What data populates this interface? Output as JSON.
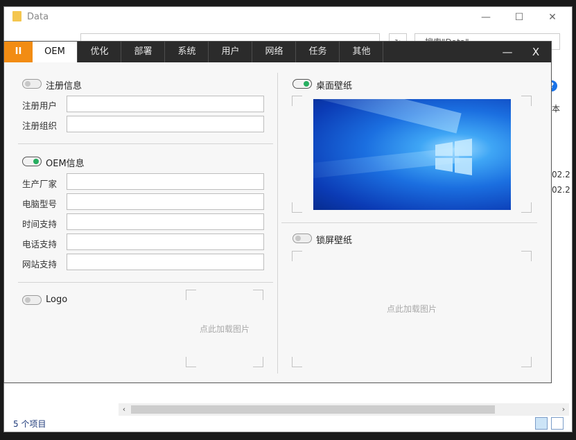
{
  "explorer": {
    "title": "Data",
    "window_controls": {
      "minimize": "—",
      "maximize": "☐",
      "close": "✕"
    },
    "search_placeholder": "搜索\"Data\"",
    "side_text": [
      "本",
      "02.2",
      "02.2"
    ],
    "status": "5 个项目"
  },
  "app": {
    "tabs": [
      {
        "label": "OEM",
        "active": true
      },
      {
        "label": "优化",
        "active": false
      },
      {
        "label": "部署",
        "active": false
      },
      {
        "label": "系统",
        "active": false
      },
      {
        "label": "用户",
        "active": false
      },
      {
        "label": "网络",
        "active": false
      },
      {
        "label": "任务",
        "active": false
      },
      {
        "label": "其他",
        "active": false
      }
    ],
    "pause_label": "II",
    "minimize_label": "—",
    "close_label": "X"
  },
  "oem": {
    "registration": {
      "label": "注册信息",
      "enabled": false,
      "fields": [
        {
          "label": "注册用户",
          "value": ""
        },
        {
          "label": "注册组织",
          "value": ""
        }
      ]
    },
    "oem_info": {
      "label": "OEM信息",
      "enabled": true,
      "fields": [
        {
          "label": "生产厂家",
          "value": ""
        },
        {
          "label": "电脑型号",
          "value": ""
        },
        {
          "label": "时间支持",
          "value": ""
        },
        {
          "label": "电话支持",
          "value": ""
        },
        {
          "label": "网站支持",
          "value": ""
        }
      ]
    },
    "logo": {
      "label": "Logo",
      "enabled": false,
      "placeholder": "点此加载图片"
    },
    "desktop_wallpaper": {
      "label": "桌面壁纸",
      "enabled": true
    },
    "lock_wallpaper": {
      "label": "锁屏壁纸",
      "enabled": false,
      "placeholder": "点此加载图片"
    }
  },
  "colors": {
    "accent_orange": "#f28c13",
    "toggle_on_green": "#27ae60",
    "tabbar_dark": "#2b2b2b"
  }
}
